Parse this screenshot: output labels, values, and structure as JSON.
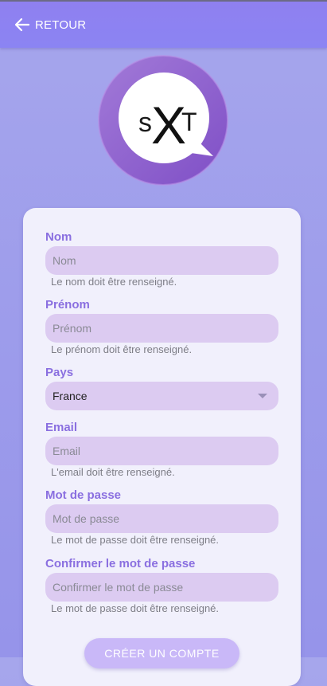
{
  "header": {
    "back_label": "RETOUR",
    "back_icon": "arrow-left-icon"
  },
  "logo": {
    "text_s": "s",
    "text_x": "X",
    "text_t": "T"
  },
  "form": {
    "nom": {
      "label": "Nom",
      "placeholder": "Nom",
      "value": "",
      "help": "Le nom doit être renseigné."
    },
    "prenom": {
      "label": "Prénom",
      "placeholder": "Prénom",
      "value": "",
      "help": "Le prénom doit être renseigné."
    },
    "pays": {
      "label": "Pays",
      "selected": "France"
    },
    "email": {
      "label": "Email",
      "placeholder": "Email",
      "value": "",
      "help": "L'email doit être renseigné."
    },
    "password": {
      "label": "Mot de passe",
      "placeholder": "Mot de passe",
      "value": "",
      "help": "Le mot de passe doit être renseigné."
    },
    "confirm": {
      "label": "Confirmer le mot de passe",
      "placeholder": "Confirmer le mot de passe",
      "value": "",
      "help": "Le mot de passe doit être renseigné."
    },
    "submit_label": "CRÉER UN COMPTE"
  },
  "colors": {
    "accent": "#8a6fe0",
    "input_bg": "#dccbf1",
    "button": "#c9b8f8",
    "header": "#8b82f1"
  }
}
